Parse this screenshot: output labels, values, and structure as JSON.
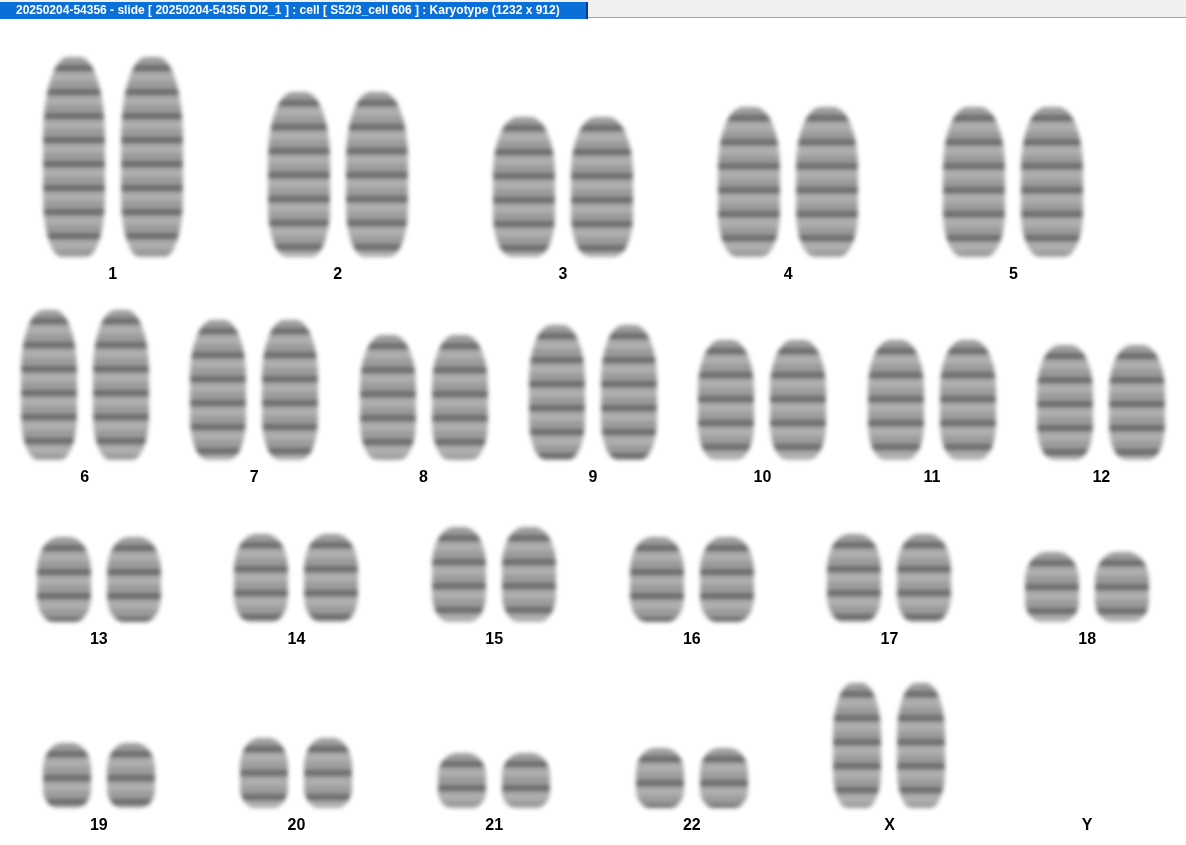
{
  "window": {
    "title": "20250204-54356 - slide [ 20250204-54356 DI2_1 ] : cell [ S52/3_cell 606 ] : Karyotype  (1232 x 912)"
  },
  "karyotype": {
    "rows": [
      [
        {
          "label": "1",
          "empty": false
        },
        {
          "label": "2",
          "empty": false
        },
        {
          "label": "3",
          "empty": false
        },
        {
          "label": "4",
          "empty": false
        },
        {
          "label": "5",
          "empty": false
        }
      ],
      [
        {
          "label": "6",
          "empty": false
        },
        {
          "label": "7",
          "empty": false
        },
        {
          "label": "8",
          "empty": false
        },
        {
          "label": "9",
          "empty": false
        },
        {
          "label": "10",
          "empty": false
        },
        {
          "label": "11",
          "empty": false
        },
        {
          "label": "12",
          "empty": false
        }
      ],
      [
        {
          "label": "13",
          "empty": false
        },
        {
          "label": "14",
          "empty": false
        },
        {
          "label": "15",
          "empty": false
        },
        {
          "label": "16",
          "empty": false
        },
        {
          "label": "17",
          "empty": false
        },
        {
          "label": "18",
          "empty": false
        }
      ],
      [
        {
          "label": "19",
          "empty": false
        },
        {
          "label": "20",
          "empty": false
        },
        {
          "label": "21",
          "empty": false
        },
        {
          "label": "22",
          "empty": false
        },
        {
          "label": "X",
          "empty": false
        },
        {
          "label": "Y",
          "empty": true
        }
      ]
    ]
  }
}
